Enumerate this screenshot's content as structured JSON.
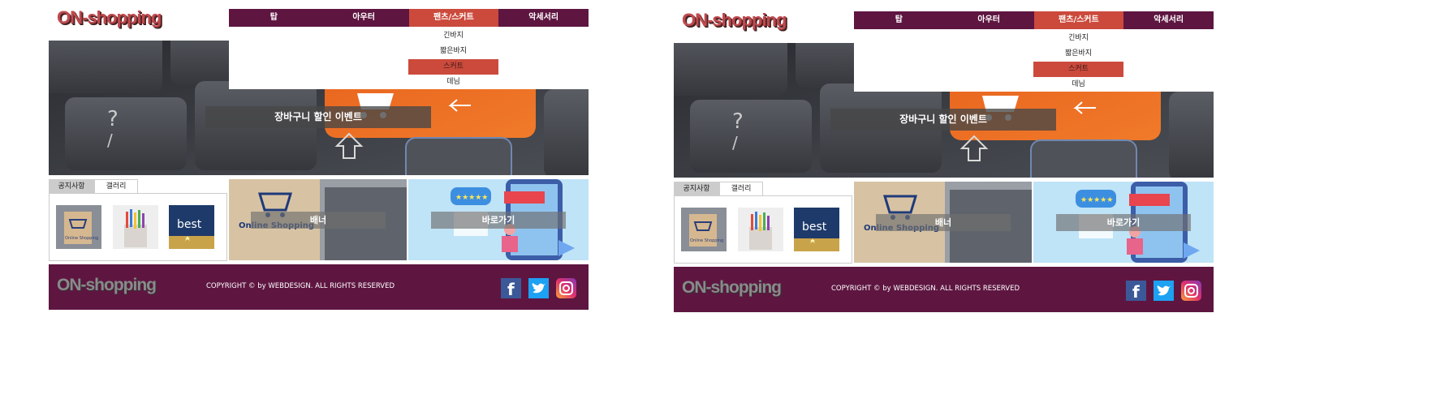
{
  "panels": [
    {
      "logo": "ON-shopping",
      "nav": [
        {
          "label": "탑"
        },
        {
          "label": "아우터"
        },
        {
          "label": "팬츠/스커트"
        },
        {
          "label": "악세서리"
        }
      ],
      "submenu": [
        "긴바지",
        "짧은바지",
        "스커트",
        "데님"
      ],
      "slide_caption": "장바구니 할인 이벤트",
      "tabs": [
        "공지사항",
        "갤러리"
      ],
      "gallery_texts": [
        "Online Shopping",
        "best"
      ],
      "banner_text": "Online Shopping",
      "banner_label": "배너",
      "shortcut_label": "바로가기",
      "footer_logo": "ON-shopping",
      "copyright": "COPYRIGHT © by WEBDESIGN. ALL RIGHTS RESERVED",
      "sns": [
        "facebook-icon",
        "twitter-icon",
        "instagram-icon"
      ]
    },
    {
      "logo": "ON-shopping",
      "nav": [
        {
          "label": "탑"
        },
        {
          "label": "아우터"
        },
        {
          "label": "팬츠/스커트"
        },
        {
          "label": "악세서리"
        }
      ],
      "submenu": [
        "긴바지",
        "짧은바지",
        "스커트",
        "데님"
      ],
      "slide_caption": "장바구니 할인 이벤트",
      "tabs": [
        "공지사항",
        "갤러리"
      ],
      "gallery_texts": [
        "Online Shopping",
        "best"
      ],
      "banner_text": "Online Shopping",
      "banner_label": "배너",
      "shortcut_label": "바로가기",
      "footer_logo": "ON-shopping",
      "copyright": "COPYRIGHT © by WEBDESIGN. ALL RIGHTS RESERVED",
      "sns": [
        "facebook-icon",
        "twitter-icon",
        "instagram-icon"
      ]
    }
  ],
  "colors": {
    "brand_primary": "#5e1641",
    "accent": "#cb4a3c",
    "logo_red": "#c04a4f"
  }
}
